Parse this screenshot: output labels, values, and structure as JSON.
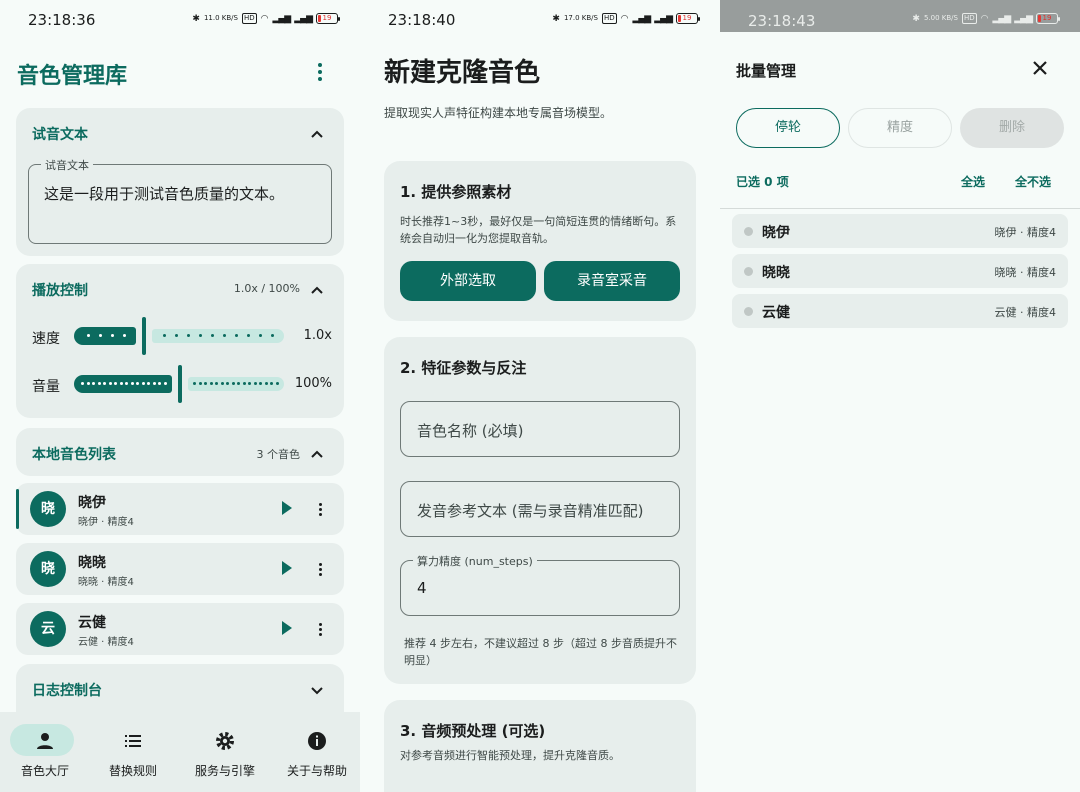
{
  "colors": {
    "accent": "#0c6b5f",
    "surface": "#e7eeec",
    "background": "#f6fbf9",
    "accent_container": "#c7e8e1"
  },
  "screen1": {
    "status": {
      "time": "23:18:36",
      "net_speed": "11.0 KB/S",
      "battery": "19"
    },
    "title": "音色管理库",
    "trial_text": {
      "title": "试音文本",
      "field_label": "试音文本",
      "value": "这是一段用于测试音色质量的文本。"
    },
    "playback": {
      "title": "播放控制",
      "summary": "1.0x / 100%",
      "speed": {
        "label": "速度",
        "value_text": "1.0x",
        "fraction": 0.33
      },
      "volume": {
        "label": "音量",
        "value_text": "100%",
        "fraction": 0.5
      }
    },
    "voice_list": {
      "title": "本地音色列表",
      "count": "3 个音色",
      "items": [
        {
          "avatar": "晓",
          "name": "晓伊",
          "sub": "晓伊 · 精度4",
          "selected": true
        },
        {
          "avatar": "晓",
          "name": "晓晓",
          "sub": "晓晓 · 精度4",
          "selected": false
        },
        {
          "avatar": "云",
          "name": "云健",
          "sub": "云健 · 精度4",
          "selected": false
        }
      ]
    },
    "log_console": {
      "title": "日志控制台"
    },
    "nav": [
      {
        "label": "音色大厅",
        "icon": "person-icon",
        "active": true
      },
      {
        "label": "替换规则",
        "icon": "list-icon",
        "active": false
      },
      {
        "label": "服务与引擎",
        "icon": "gear-icon",
        "active": false
      },
      {
        "label": "关于与帮助",
        "icon": "info-icon",
        "active": false
      }
    ]
  },
  "screen2": {
    "status": {
      "time": "23:18:40",
      "net_speed": "17.0 KB/S",
      "battery": "19"
    },
    "title": "新建克隆音色",
    "description": "提取现实人声特征构建本地专属音场模型。",
    "section1": {
      "title": "1. 提供参照素材",
      "text": "时长推荐1~3秒，最好仅是一句简短连贯的情绪断句。系统会自动归一化为您提取音轨。",
      "btn_external": "外部选取",
      "btn_record": "录音室采音"
    },
    "section2": {
      "title": "2. 特征参数与反注",
      "name_placeholder": "音色名称 (必填)",
      "ref_placeholder": "发音参考文本 (需与录音精准匹配)",
      "steps_label": "算力精度 (num_steps)",
      "steps_value": "4",
      "hint": "推荐 4 步左右，不建议超过 8 步（超过 8 步音质提升不明显）"
    },
    "section3": {
      "title": "3. 音频预处理 (可选)",
      "text": "对参考音频进行智能预处理，提升克隆音质。"
    }
  },
  "screen3": {
    "status": {
      "time": "23:18:43",
      "net_speed": "5.00 KB/S",
      "battery": "19"
    },
    "title": "批量管理",
    "actions": {
      "stop": "停轮",
      "precision": "精度",
      "delete": "删除"
    },
    "selected_count": "已选 0 项",
    "select_all": "全选",
    "select_none": "全不选",
    "items": [
      {
        "name": "晓伊",
        "sub": "晓伊 · 精度4"
      },
      {
        "name": "晓晓",
        "sub": "晓晓 · 精度4"
      },
      {
        "name": "云健",
        "sub": "云健 · 精度4"
      }
    ]
  }
}
